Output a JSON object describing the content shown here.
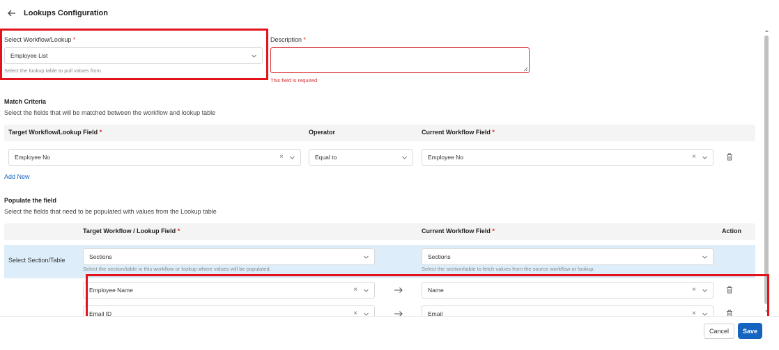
{
  "header": {
    "title": "Lookups Configuration",
    "back_icon": "arrow-left-icon"
  },
  "workflow": {
    "label": "Select Workflow/Lookup",
    "required": "*",
    "value": "Employee List",
    "helper": "Select the lookup table to pull values from"
  },
  "description": {
    "label": "Description",
    "required": "*",
    "value": "",
    "error": "This field is required"
  },
  "match": {
    "title": "Match Criteria",
    "subtitle": "Select the fields that will be matched between the workflow and lookup table",
    "headers": {
      "target": "Target Workflow/Lookup Field",
      "operator": "Operator",
      "current": "Current Workflow Field",
      "required": "*"
    },
    "row": {
      "target": "Employee No",
      "operator": "Equal to",
      "current": "Employee No"
    },
    "add_new": "Add New"
  },
  "populate": {
    "title": "Populate the field",
    "subtitle": "Select the fields that need to be populated with values from the Lookup table",
    "headers": {
      "target": "Target Workflow / Lookup Field",
      "current": "Current Workflow Field",
      "action": "Action",
      "required": "*"
    },
    "section_row": {
      "label": "Select Section/Table",
      "target_value": "Sections",
      "target_helper": "Select the section/table in this workflow or lookup where values will be populated.",
      "current_value": "Sections",
      "current_helper": "Select the section/table to fetch values from the source workflow or lookup."
    },
    "rows": [
      {
        "target": "Employee Name",
        "current": "Name"
      },
      {
        "target": "Email ID",
        "current": "Email"
      }
    ]
  },
  "footer": {
    "cancel": "Cancel",
    "save": "Save"
  },
  "colors": {
    "primary": "#1565c0",
    "error": "#d32f2f",
    "highlight": "#e3131c",
    "section_band": "#ddeefa"
  }
}
